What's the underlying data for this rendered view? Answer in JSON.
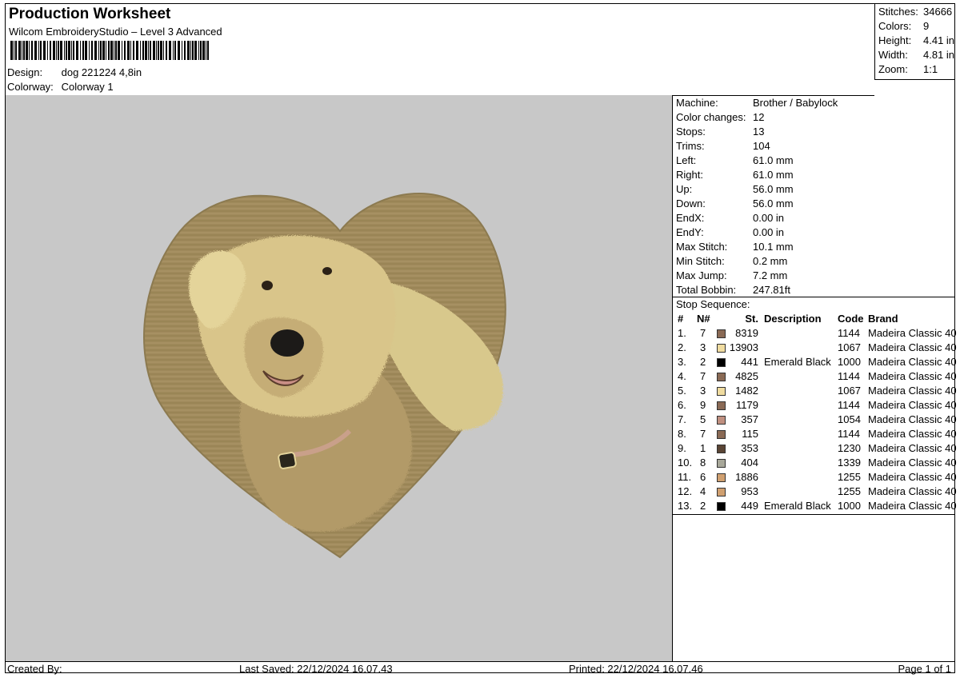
{
  "header": {
    "title": "Production Worksheet",
    "subtitle": "Wilcom EmbroideryStudio – Level 3 Advanced",
    "design_label": "Design:",
    "design_value": "dog 221224 4,8in",
    "colorway_label": "Colorway:",
    "colorway_value": "Colorway 1"
  },
  "summary": [
    {
      "label": "Stitches:",
      "value": "34666"
    },
    {
      "label": "Colors:",
      "value": "9"
    },
    {
      "label": "Height:",
      "value": "4.41 in"
    },
    {
      "label": "Width:",
      "value": "4.81 in"
    },
    {
      "label": "Zoom:",
      "value": "1:1"
    }
  ],
  "machine_info": [
    {
      "label": "Machine:",
      "value": "Brother / Babylock"
    },
    {
      "label": "Color changes:",
      "value": "12"
    },
    {
      "label": "Stops:",
      "value": "13"
    },
    {
      "label": "Trims:",
      "value": "104"
    },
    {
      "label": "Left:",
      "value": "61.0 mm"
    },
    {
      "label": "Right:",
      "value": "61.0 mm"
    },
    {
      "label": "Up:",
      "value": "56.0 mm"
    },
    {
      "label": "Down:",
      "value": "56.0 mm"
    },
    {
      "label": "EndX:",
      "value": "0.00 in"
    },
    {
      "label": "EndY:",
      "value": "0.00 in"
    },
    {
      "label": "Max Stitch:",
      "value": "10.1 mm"
    },
    {
      "label": "Min Stitch:",
      "value": "0.2 mm"
    },
    {
      "label": "Max Jump:",
      "value": "7.2 mm"
    },
    {
      "label": "Total Bobbin:",
      "value": "247.81ft"
    }
  ],
  "stop_sequence": {
    "heading": "Stop Sequence:",
    "columns": {
      "num": "#",
      "needle": "N#",
      "stitches": "St.",
      "description": "Description",
      "code": "Code",
      "brand": "Brand"
    },
    "rows": [
      {
        "num": "1.",
        "needle": "7",
        "color": "#8a6a55",
        "stitches": "8319",
        "description": "",
        "code": "1144",
        "brand": "Madeira Classic 40"
      },
      {
        "num": "2.",
        "needle": "3",
        "color": "#f0dca0",
        "stitches": "13903",
        "description": "",
        "code": "1067",
        "brand": "Madeira Classic 40"
      },
      {
        "num": "3.",
        "needle": "2",
        "color": "#000000",
        "stitches": "441",
        "description": "Emerald Black",
        "code": "1000",
        "brand": "Madeira Classic 40"
      },
      {
        "num": "4.",
        "needle": "7",
        "color": "#8a6a55",
        "stitches": "4825",
        "description": "",
        "code": "1144",
        "brand": "Madeira Classic 40"
      },
      {
        "num": "5.",
        "needle": "3",
        "color": "#f0dca0",
        "stitches": "1482",
        "description": "",
        "code": "1067",
        "brand": "Madeira Classic 40"
      },
      {
        "num": "6.",
        "needle": "9",
        "color": "#8a6a55",
        "stitches": "1179",
        "description": "",
        "code": "1144",
        "brand": "Madeira Classic 40"
      },
      {
        "num": "7.",
        "needle": "5",
        "color": "#c09080",
        "stitches": "357",
        "description": "",
        "code": "1054",
        "brand": "Madeira Classic 40"
      },
      {
        "num": "8.",
        "needle": "7",
        "color": "#8a6a55",
        "stitches": "115",
        "description": "",
        "code": "1144",
        "brand": "Madeira Classic 40"
      },
      {
        "num": "9.",
        "needle": "1",
        "color": "#5a4535",
        "stitches": "353",
        "description": "",
        "code": "1230",
        "brand": "Madeira Classic 40"
      },
      {
        "num": "10.",
        "needle": "8",
        "color": "#a8a89a",
        "stitches": "404",
        "description": "",
        "code": "1339",
        "brand": "Madeira Classic 40"
      },
      {
        "num": "11.",
        "needle": "6",
        "color": "#d0a070",
        "stitches": "1886",
        "description": "",
        "code": "1255",
        "brand": "Madeira Classic 40"
      },
      {
        "num": "12.",
        "needle": "4",
        "color": "#d0a070",
        "stitches": "953",
        "description": "",
        "code": "1255",
        "brand": "Madeira Classic 40"
      },
      {
        "num": "13.",
        "needle": "2",
        "color": "#000000",
        "stitches": "449",
        "description": "Emerald Black",
        "code": "1000",
        "brand": "Madeira Classic 40"
      }
    ]
  },
  "footer": {
    "created_by": "Created By:",
    "last_saved": "Last Saved: 22/12/2024 16.07.43",
    "printed": "Printed: 22/12/2024 16.07.46",
    "page": "Page 1 of 1"
  },
  "design_preview": {
    "heart_color": "#a08a5c",
    "fur_light": "#e3d49a",
    "fur_mid": "#c4aa72",
    "fur_dark": "#8c7248",
    "background": "#c8c8c8"
  }
}
